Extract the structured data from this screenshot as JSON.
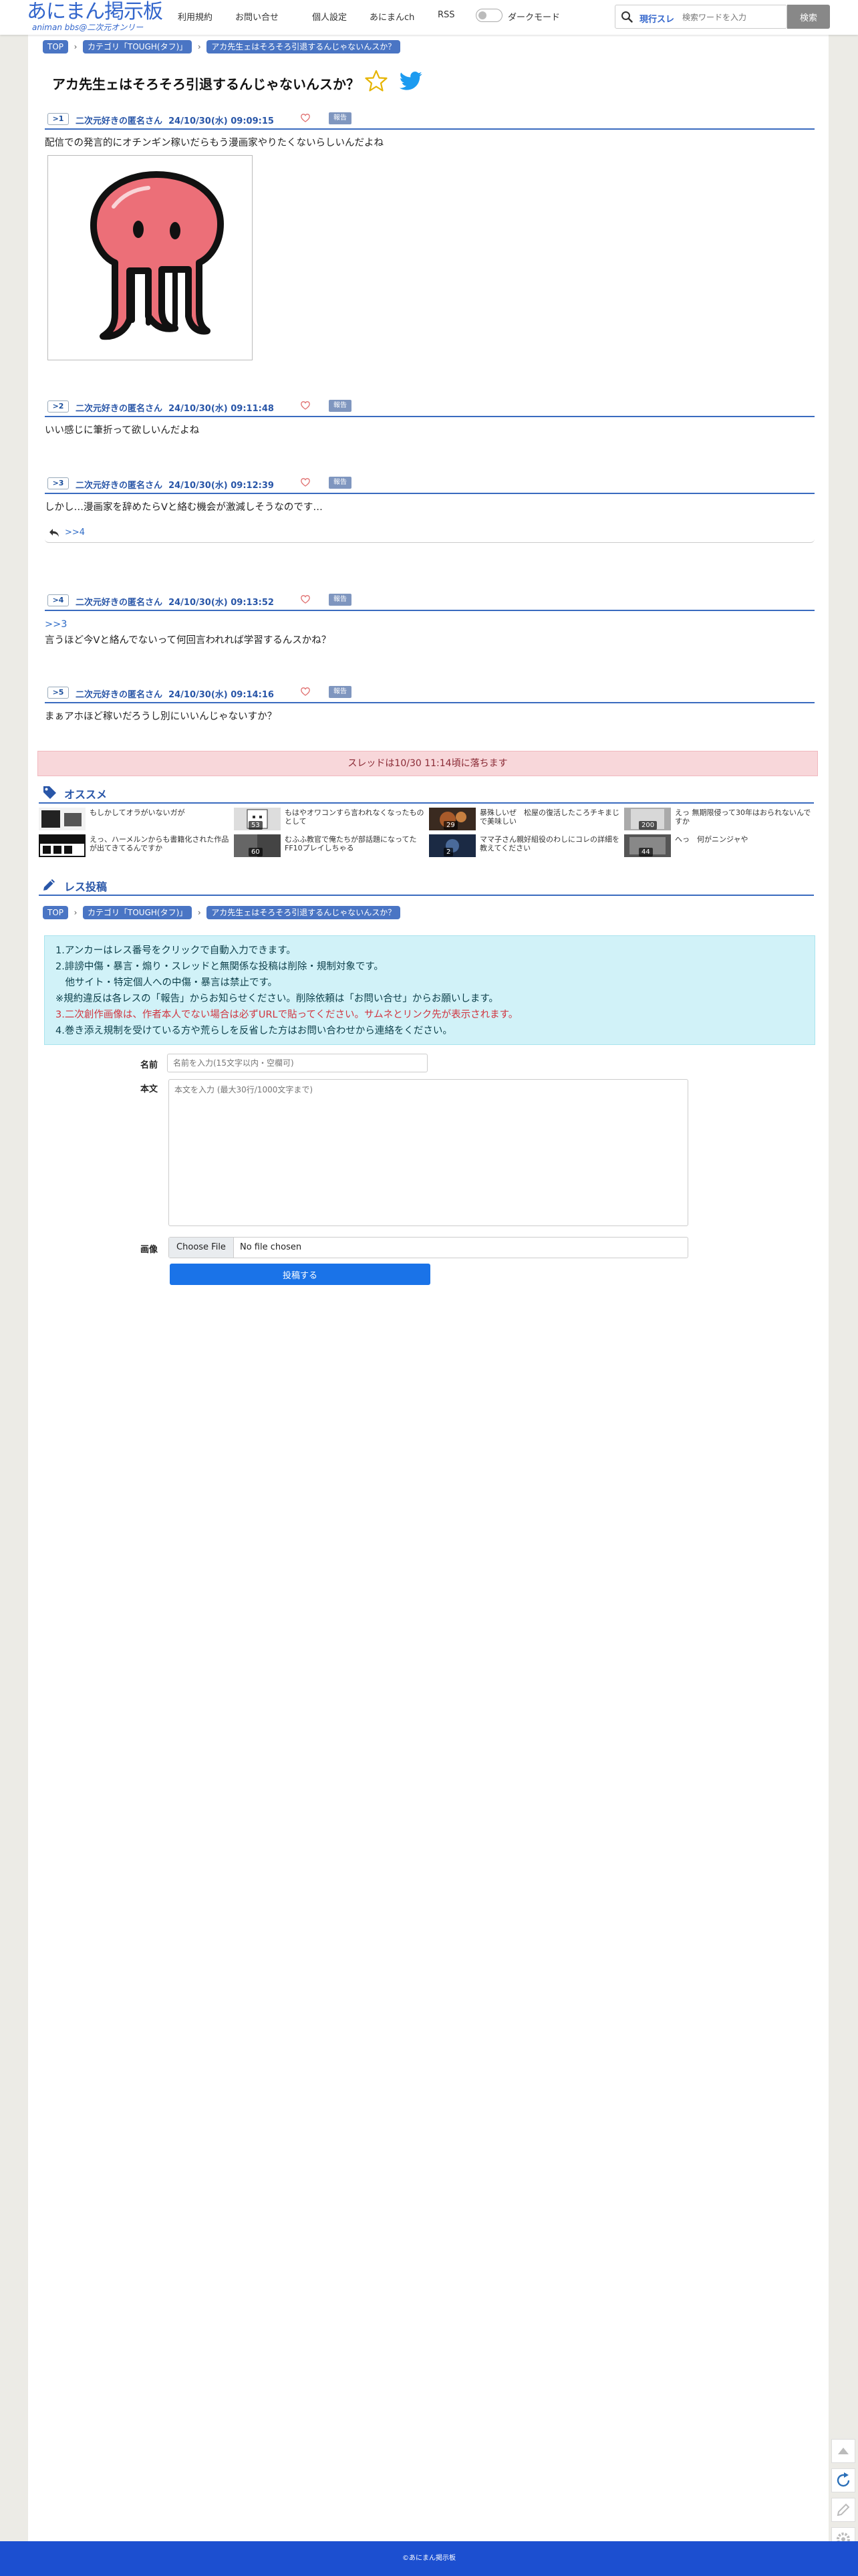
{
  "header": {
    "logo_main": "あにまん掲示板",
    "logo_sub": "animan bbs@二次元オンリー",
    "nav": [
      "利用規約",
      "お問い合せ",
      "個人設定",
      "あにまんch",
      "RSS"
    ],
    "dark_mode_label": "ダークモード",
    "search_hot_label": "現行スレ",
    "search_placeholder": "検索ワードを入力",
    "search_button": "検索"
  },
  "breadcrumb": [
    "TOP",
    "カテゴリ「TOUGH(タフ)」",
    "アカ先生ェはそろそろ引退するんじゃないんスか？"
  ],
  "thread": {
    "title": "アカ先生ェはそろそろ引退するんじゃないんスか？"
  },
  "posts": [
    {
      "no": ">1",
      "name": "二次元好きの匿名さん",
      "date": "24/10/30(水) 09:09:15",
      "report": "報告",
      "body": "配信での発言的にオチンギン稼いだらもう漫画家やりたくないらしいんだよね"
    },
    {
      "no": ">2",
      "name": "二次元好きの匿名さん",
      "date": "24/10/30(水) 09:11:48",
      "report": "報告",
      "body": "いい感じに筆折って欲しいんだよね"
    },
    {
      "no": ">3",
      "name": "二次元好きの匿名さん",
      "date": "24/10/30(水) 09:12:39",
      "report": "報告",
      "body": "しかし…漫画家を辞めたらVと絡む機会が激減しそうなのです…",
      "reply_link": ">>4"
    },
    {
      "no": ">4",
      "name": "二次元好きの匿名さん",
      "date": "24/10/30(水) 09:13:52",
      "report": "報告",
      "anchor": ">>3",
      "body": "言うほど今Vと絡んでないって何回言われれば学習するんスかね？"
    },
    {
      "no": ">5",
      "name": "二次元好きの匿名さん",
      "date": "24/10/30(水) 09:14:16",
      "report": "報告",
      "body": "まぁアホほど稼いだろうし別にいいんじゃないすか？"
    }
  ],
  "fallen_notice": "スレッドは10/30 11:14頃に落ちます",
  "recommend": {
    "title": "オススメ",
    "items": [
      {
        "text": "もしかしてオラがいないガが",
        "count": ""
      },
      {
        "text": "もはやオワコンすら言われなくなったものとして",
        "count": "53"
      },
      {
        "text": "暴殊しいぜ　松屋の復活したころチキまじで美味しい",
        "count": "29"
      },
      {
        "text": "えっ 無期限侵って30年はおられないんですか",
        "count": "200"
      },
      {
        "text": "えっ、ハーメルンからも書籍化された作品が出てきてるんですか",
        "count": ""
      },
      {
        "text": "むふふ教官で俺たちが部話題になってたFF10プレイしちゃる",
        "count": "60"
      },
      {
        "text": "ママ子さん親好組役のわしにコレの詳細を教えてください",
        "count": "2"
      },
      {
        "text": "へっ　何がニンジャや",
        "count": "44"
      }
    ]
  },
  "reply_form": {
    "title": "レス投稿",
    "notice_lines": [
      "1.アンカーはレス番号をクリックで自動入力できます。",
      "2.誹謗中傷・暴言・煽り・スレッドと無関係な投稿は削除・規制対象です。",
      "　他サイト・特定個人への中傷・暴言は禁止です。",
      "※規約違反は各レスの「報告」からお知らせください。削除依頼は「お問い合せ」からお願いします。",
      "3.二次創作画像は、作者本人でない場合は必ずURLで貼ってください。サムネとリンク先が表示されます。",
      "4.巻き添え規制を受けている方や荒らしを反省した方はお問い合わせから連絡をください。"
    ],
    "name_label": "名前",
    "name_placeholder": "名前を入力(15文字以内・空欄可)",
    "body_label": "本文",
    "body_placeholder": "本文を入力 (最大30行/1000文字まで)",
    "image_label": "画像",
    "file_button": "Choose File",
    "file_status": "No file chosen",
    "submit": "投稿する"
  },
  "footer": {
    "copyright": "©あにまん掲示板"
  },
  "colors": {
    "accent": "#3366cc",
    "post_rule": "#3a6bbf",
    "alert_bg": "#f8d7da",
    "notice_bg": "#d1f2f8",
    "submit": "#1a73e8",
    "footer": "#1c4fd0"
  },
  "icons": [
    "search-icon",
    "star-icon",
    "twitter-icon",
    "heart-icon",
    "reply-icon",
    "tag-icon",
    "pencil-icon",
    "scroll-top-icon",
    "reload-icon",
    "edit-icon",
    "settings-icon"
  ]
}
